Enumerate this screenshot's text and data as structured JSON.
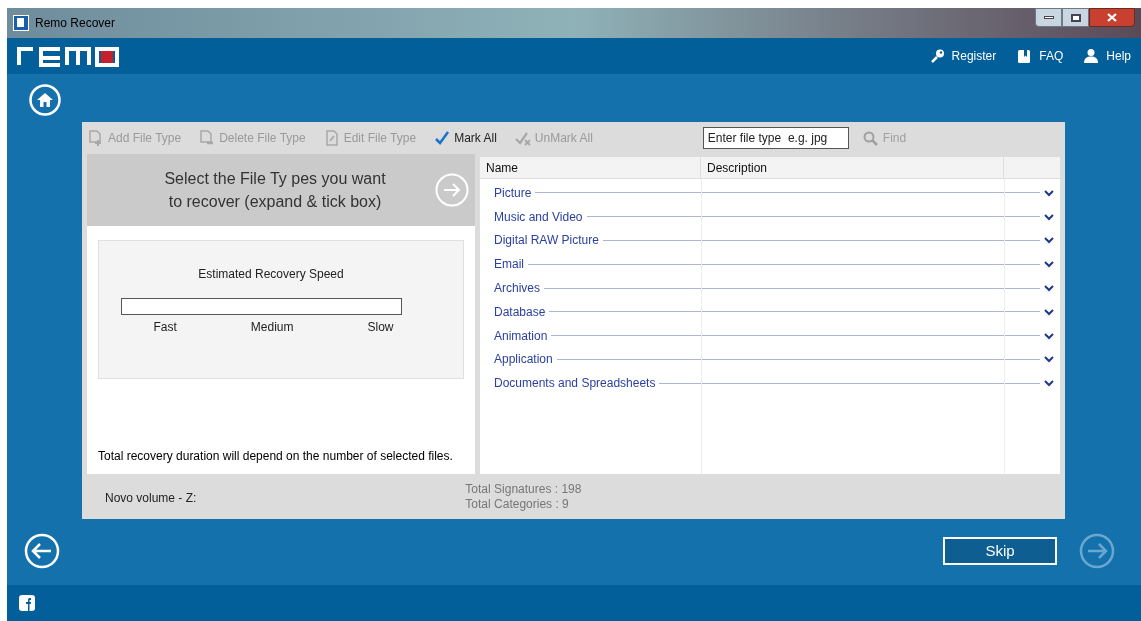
{
  "window": {
    "title": "Remo Recover"
  },
  "header_links": [
    {
      "kind": "key",
      "label": "Register"
    },
    {
      "kind": "book",
      "label": "FAQ"
    },
    {
      "kind": "person",
      "label": "Help"
    }
  ],
  "toolbar": [
    {
      "kind": "add",
      "label": "Add File Type",
      "disabled": true
    },
    {
      "kind": "delete",
      "label": "Delete File Type",
      "disabled": true
    },
    {
      "kind": "edit",
      "label": "Edit File Type",
      "disabled": true
    },
    {
      "kind": "mark",
      "label": "Mark All",
      "disabled": false
    },
    {
      "kind": "unmark",
      "label": "UnMark All",
      "disabled": true
    }
  ],
  "search": {
    "placeholder": "Enter file type  e.g. jpg",
    "button": "Find",
    "disabled": true
  },
  "instructions": {
    "title": "Select the File Ty pes you want to recover (expand & tick box)"
  },
  "speed": {
    "title": "Estimated Recovery Speed",
    "level": 0,
    "labels": [
      "Fast",
      "Medium",
      "Slow"
    ]
  },
  "note": "Total recovery duration will depend on the number of selected files.",
  "table": {
    "columns": [
      "Name",
      "Description"
    ],
    "rows": [
      {
        "name": "Picture",
        "expanded": false
      },
      {
        "name": "Music and Video",
        "expanded": false
      },
      {
        "name": "Digital RAW Picture",
        "expanded": false
      },
      {
        "name": "Email",
        "expanded": false
      },
      {
        "name": "Archives",
        "expanded": false
      },
      {
        "name": "Database",
        "expanded": false
      },
      {
        "name": "Animation",
        "expanded": false
      },
      {
        "name": "Application",
        "expanded": false
      },
      {
        "name": "Documents and Spreadsheets",
        "expanded": false
      }
    ]
  },
  "status_bar": {
    "volume": "Novo volume - Z:",
    "stats": [
      "Total Signatures : 198",
      "Total Categories : 9"
    ]
  },
  "navigation": {
    "back_disabled": false,
    "skip": "Skip",
    "next_disabled": true
  }
}
